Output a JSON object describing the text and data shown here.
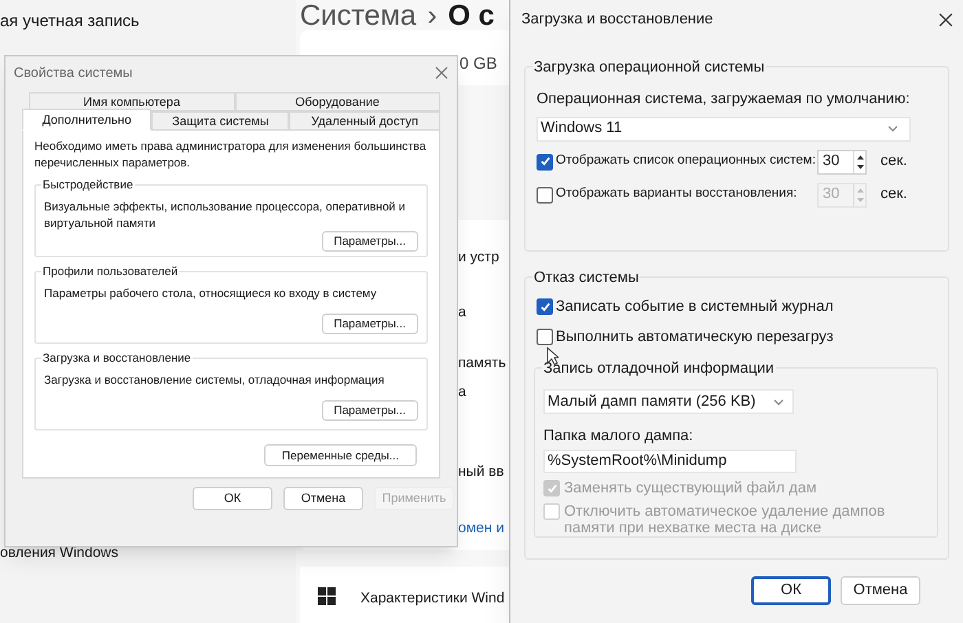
{
  "background": {
    "account": "ая учетная запись",
    "breadcrumb": [
      "Система",
      "›",
      "О с"
    ],
    "storage": "0 GB",
    "fragments": [
      {
        "text": "и устр",
        "kind": "row"
      },
      {
        "text": "а",
        "kind": "row"
      },
      {
        "text": "память",
        "kind": "row"
      },
      {
        "text": "а",
        "kind": "row"
      },
      {
        "text": "ный вв",
        "kind": "row"
      },
      {
        "text": "омен и",
        "kind": "link"
      },
      {
        "text": "овления Windows",
        "kind": "sidebar"
      }
    ],
    "specs": "Характеристики Wind"
  },
  "system_properties": {
    "title": "Свойства системы",
    "tabs": [
      {
        "label": "Имя компьютера",
        "selected": false
      },
      {
        "label": "Оборудование",
        "selected": false
      },
      {
        "label": "Дополнительно",
        "selected": true
      },
      {
        "label": "Защита системы",
        "selected": false
      },
      {
        "label": "Удаленный доступ",
        "selected": false
      }
    ],
    "intro": "Необходимо иметь права администратора для изменения большинства перечисленных параметров.",
    "groups": [
      {
        "title": "Быстродействие",
        "description": "Визуальные эффекты, использование процессора, оперативной и виртуальной памяти",
        "button": "Параметры..."
      },
      {
        "title": "Профили пользователей",
        "description": "Параметры рабочего стола, относящиеся ко входу в систему",
        "button": "Параметры..."
      },
      {
        "title": "Загрузка и восстановление",
        "description": "Загрузка и восстановление системы, отладочная информация",
        "button": "Параметры..."
      }
    ],
    "env_button": "Переменные среды...",
    "buttons": [
      {
        "label": "ОК",
        "disabled": false
      },
      {
        "label": "Отмена",
        "disabled": false
      },
      {
        "label": "Применить",
        "disabled": true
      }
    ]
  },
  "startup_recovery": {
    "title": "Загрузка и восстановление",
    "startup": {
      "title": "Загрузка операционной системы",
      "default_os_label": "Операционная система, загружаемая по умолчанию:",
      "default_os": "Windows 11",
      "options": [
        {
          "label": "Отображать список операционных систем:",
          "checked": true,
          "value": "30",
          "unit": "сек."
        },
        {
          "label": "Отображать варианты восстановления:",
          "checked": false,
          "value": "30",
          "unit": "сек."
        }
      ]
    },
    "failure": {
      "title": "Отказ системы",
      "options": [
        {
          "label": "Записать событие в системный журнал",
          "checked": true
        },
        {
          "label": "Выполнить автоматическую перезагруз",
          "checked": false
        }
      ],
      "debug": {
        "title": "Запись отладочной информации",
        "dump_type": "Малый дамп памяти (256 KB)",
        "folder_label": "Папка малого дампа:",
        "folder": "%SystemRoot%\\Minidump",
        "options": [
          {
            "label": "Заменять существующий файл дам",
            "checked": true,
            "disabled": true
          },
          {
            "label": "Отключить автоматическое удаление дампов памяти при нехватке места на диске",
            "checked": false,
            "disabled": true
          }
        ]
      }
    },
    "buttons": [
      "ОК",
      "Отмена"
    ]
  }
}
